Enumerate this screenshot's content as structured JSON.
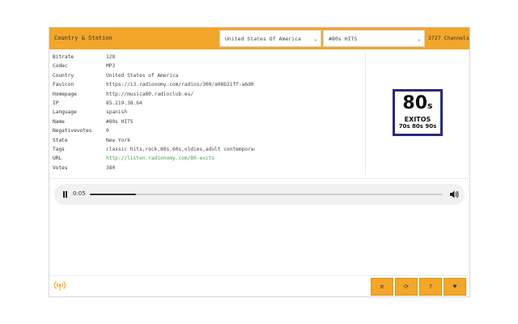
{
  "header": {
    "title": "Country & Station",
    "country_select": "United States Of America",
    "station_select": "#80s HITS",
    "channels": "3727 Channels"
  },
  "info_rows": [
    {
      "key": "Bitrate",
      "value": "128"
    },
    {
      "key": "Codec",
      "value": "MP3"
    },
    {
      "key": "Country",
      "value": "United States of America"
    },
    {
      "key": "Favicon",
      "value": "https://i3.radionomy.com/radios/300/a08b31ff-a6d0-498…"
    },
    {
      "key": "Homepage",
      "value": "http://musica80.radioclub.es/"
    },
    {
      "key": "IP",
      "value": "85.219.38.64"
    },
    {
      "key": "Language",
      "value": "spanish"
    },
    {
      "key": "Name",
      "value": "#80s HITS"
    },
    {
      "key": "Negativevotes",
      "value": "0"
    },
    {
      "key": "State",
      "value": "New York"
    },
    {
      "key": "Tags",
      "value": "classic hits,rock,80s,60s,oldies,adult contemporary,a…"
    },
    {
      "key": "URL",
      "value": "http://listen.radionomy.com/80-exits"
    },
    {
      "key": "Votes",
      "value": "380"
    }
  ],
  "logo": {
    "big": "80",
    "big_suffix": "s",
    "mid": "EXITOS",
    "low": "70s 80s 90s"
  },
  "player": {
    "time": "0:05",
    "progress": 0.13
  },
  "footer": {
    "buttons": [
      "≡",
      "⟳",
      "?",
      "♥"
    ]
  },
  "colors": {
    "accent": "#f2a62a",
    "link": "#4a9a4a",
    "logo_border": "#2a2a7a"
  }
}
